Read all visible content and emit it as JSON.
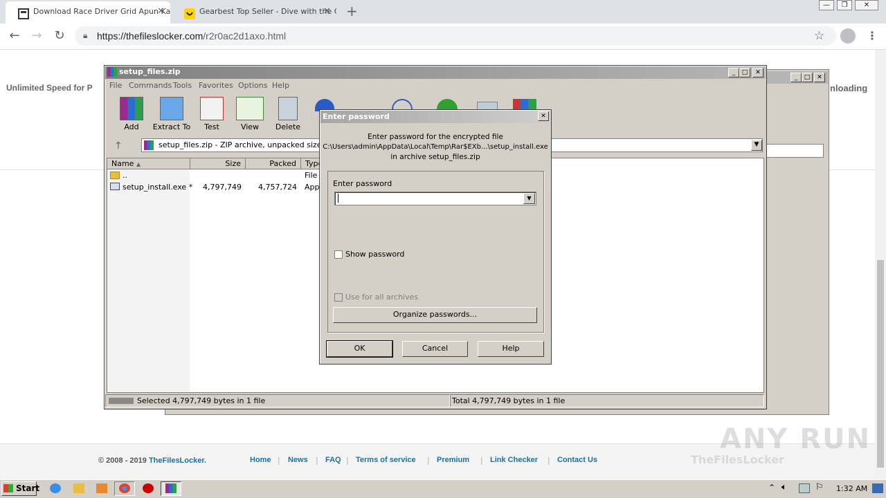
{
  "browser": {
    "tabs": [
      {
        "title": "Download Race Driver Grid Apun Ka",
        "active": true
      },
      {
        "title": "Gearbest Top Seller - Dive with the C",
        "active": false
      }
    ],
    "new_tab": "+",
    "url_host": "https://thefileslocker.com",
    "url_path": "/r2r0ac2d1axo.html",
    "window_buttons": [
      "—",
      "❐",
      "✕"
    ]
  },
  "page": {
    "promo_left": "Unlimited Speed for P",
    "promo_right": "nloading",
    "footer": {
      "copyright_prefix": "© 2008 - 2019 ",
      "copyright_brand": "TheFilesLocker.",
      "links": [
        "Home",
        "News",
        "FAQ",
        "Terms of service",
        "Premium",
        "Link Checker",
        "Contact Us"
      ],
      "logo_text": "TheFilesLocker",
      "watermark": "ANY RUN"
    }
  },
  "winrar": {
    "title": "setup_files.zip",
    "menu": [
      "File",
      "Commands",
      "Tools",
      "Favorites",
      "Options",
      "Help"
    ],
    "toolbar": [
      "Add",
      "Extract To",
      "Test",
      "View",
      "Delete"
    ],
    "path": "setup_files.zip - ZIP archive, unpacked size 4,79",
    "columns": [
      "Name",
      "Size",
      "Packed",
      "Type"
    ],
    "rows": [
      {
        "name": "..",
        "size": "",
        "packed": "",
        "type": "File f"
      },
      {
        "name": "setup_install.exe *",
        "size": "4,797,749",
        "packed": "4,757,724",
        "type": "Appl"
      }
    ],
    "status_left": "Selected 4,797,749 bytes in 1 file",
    "status_right": "Total 4,797,749 bytes in 1 file"
  },
  "dialog": {
    "title": "Enter password",
    "line1": "Enter password for the encrypted file",
    "line2": "C:\\Users\\admin\\AppData\\Local\\Temp\\Rar$EXb...\\setup_install.exe",
    "line3": "in archive setup_files.zip",
    "field_label": "Enter password",
    "password_value": "",
    "show_password": "Show password",
    "use_for_all": "Use for all archives",
    "organize": "Organize passwords...",
    "ok": "OK",
    "cancel": "Cancel",
    "help": "Help"
  },
  "taskbar": {
    "start": "Start",
    "clock": "1:32 AM"
  },
  "colors": {
    "link": "#1a6fa3",
    "win_face": "#d4d0c8"
  }
}
